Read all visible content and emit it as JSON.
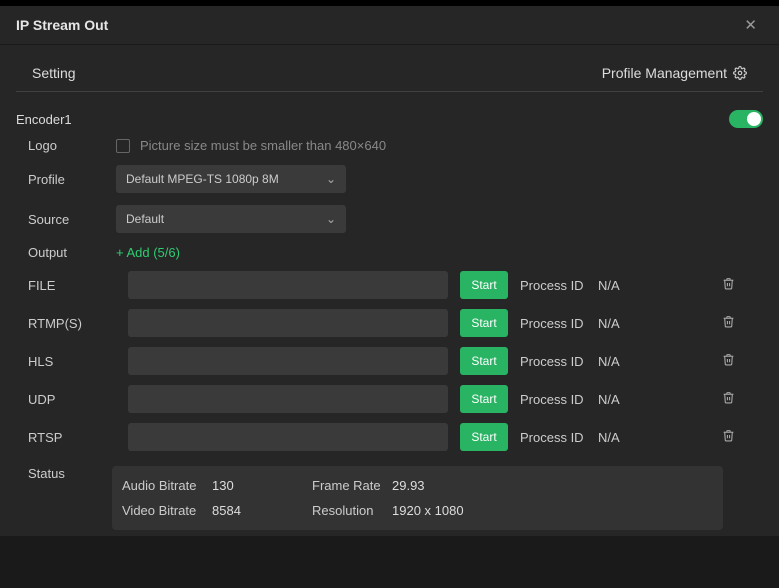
{
  "window": {
    "title": "IP Stream Out"
  },
  "subheader": {
    "left": "Setting",
    "right": "Profile Management"
  },
  "encoder": {
    "name": "Encoder1",
    "logo": {
      "label": "Logo",
      "hint": "Picture size must be smaller than 480×640"
    },
    "profile": {
      "label": "Profile",
      "value": "Default MPEG-TS 1080p 8M"
    },
    "source": {
      "label": "Source",
      "value": "Default"
    },
    "output": {
      "label": "Output",
      "add": "+ Add (5/6)"
    },
    "streams": [
      {
        "proto": "FILE",
        "start": "Start",
        "pidLabel": "Process ID",
        "pidValue": "N/A"
      },
      {
        "proto": "RTMP(S)",
        "start": "Start",
        "pidLabel": "Process ID",
        "pidValue": "N/A"
      },
      {
        "proto": "HLS",
        "start": "Start",
        "pidLabel": "Process ID",
        "pidValue": "N/A"
      },
      {
        "proto": "UDP",
        "start": "Start",
        "pidLabel": "Process ID",
        "pidValue": "N/A"
      },
      {
        "proto": "RTSP",
        "start": "Start",
        "pidLabel": "Process ID",
        "pidValue": "N/A"
      }
    ],
    "status": {
      "label": "Status",
      "audioBitrateLabel": "Audio Bitrate",
      "audioBitrateValue": "130",
      "frameRateLabel": "Frame Rate",
      "frameRateValue": "29.93",
      "videoBitrateLabel": "Video Bitrate",
      "videoBitrateValue": "8584",
      "resolutionLabel": "Resolution",
      "resolutionValue": "1920 x 1080"
    }
  }
}
